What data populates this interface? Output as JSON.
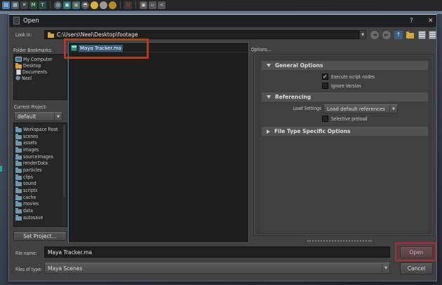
{
  "toolbar": {
    "icons": [
      {
        "name": "new-scene-icon",
        "glyph": "▤",
        "bg": "#4a7ab0",
        "fg": "#dce8f5",
        "shape": "sq"
      },
      {
        "name": "open-scene-icon",
        "glyph": "▦",
        "bg": "#4f5a66",
        "fg": "#c8d4e0",
        "shape": "sq"
      },
      {
        "name": "save-scene-icon",
        "glyph": "✕",
        "bg": "#3a4048",
        "fg": "#e8eef5",
        "shape": "sq"
      },
      {
        "name": "import-icon",
        "glyph": "M",
        "bg": "#2e4a3a",
        "fg": "#cfe8d8",
        "shape": "sq"
      },
      {
        "name": "export-icon",
        "glyph": "T",
        "bg": "#2e4a44",
        "fg": "#cfe8e0",
        "shape": "sq"
      },
      {
        "name": "sep",
        "glyph": "",
        "bg": "",
        "fg": "",
        "shape": "sep"
      },
      {
        "name": "render-globe-icon",
        "glyph": "◍",
        "bg": "#46606a",
        "fg": "#bcd",
        "shape": "round"
      },
      {
        "name": "cube-icon",
        "glyph": "▣",
        "bg": "#2e6e6e",
        "fg": "#bfe8e0",
        "shape": "sq"
      },
      {
        "name": "cube-axis-icon",
        "glyph": "▣",
        "bg": "#376f7d",
        "fg": "#e0a860",
        "shape": "sq"
      },
      {
        "name": "checker-sphere-icon",
        "glyph": "◓",
        "bg": "#5a5a5a",
        "fg": "#ddd",
        "shape": "round"
      },
      {
        "name": "yellow-sphere-icon",
        "glyph": "",
        "bg": "#d2b53c",
        "fg": "#fff",
        "shape": "round"
      },
      {
        "name": "gray-sphere-icon",
        "glyph": "",
        "bg": "#9a9a9a",
        "fg": "#fff",
        "shape": "round"
      },
      {
        "name": "gold-sphere-icon",
        "glyph": "",
        "bg": "#b8862e",
        "fg": "#fff",
        "shape": "round"
      },
      {
        "name": "sep",
        "glyph": "",
        "bg": "",
        "fg": "",
        "shape": "sep"
      },
      {
        "name": "snap-magnet-icon",
        "glyph": "U",
        "bg": "#3a3a3a",
        "fg": "#d04038",
        "shape": "sq"
      },
      {
        "name": "sep",
        "glyph": "",
        "bg": "",
        "fg": "",
        "shape": "sep"
      },
      {
        "name": "isolate-cube-icon",
        "glyph": "▣",
        "bg": "#555",
        "fg": "#ccc",
        "shape": "sq"
      },
      {
        "name": "duplicate-icon",
        "glyph": "▱",
        "bg": "#555",
        "fg": "#ccc",
        "shape": "sq"
      },
      {
        "name": "share-icon",
        "glyph": "<",
        "bg": "#555",
        "fg": "#ccc",
        "shape": "sq"
      }
    ]
  },
  "dialog": {
    "title": "Open",
    "titlebar": {
      "help": "?",
      "close": "✕"
    },
    "look_in": {
      "label": "Look in:",
      "path": "C:\\Users\\Neel\\Desktop\\footage"
    },
    "bookmarks": {
      "label": "Folder Bookmarks:",
      "items": [
        {
          "label": "My Computer",
          "icon": "computer"
        },
        {
          "label": "Desktop",
          "icon": "folder-yellow"
        },
        {
          "label": "Documents",
          "icon": "document"
        },
        {
          "label": "Neel",
          "icon": "user"
        }
      ]
    },
    "current_project": {
      "label": "Current Project:",
      "value": "default"
    },
    "projects": [
      "Workspace Root",
      "scenes",
      "assets",
      "images",
      "sourceimages",
      "renderData",
      "particles",
      "clips",
      "sound",
      "scripts",
      "cache",
      "movies",
      "data",
      "autosave"
    ],
    "set_project_label": "Set Project...",
    "file_list": {
      "selected_file": "Maya Tracker.ma"
    },
    "options": {
      "label": "Options...",
      "sections": [
        {
          "title": "General Options",
          "expanded": true,
          "checkboxes": [
            {
              "label": "Execute script nodes",
              "checked": true
            },
            {
              "label": "Ignore Version",
              "checked": false
            }
          ]
        },
        {
          "title": "Referencing",
          "expanded": true,
          "load_settings": {
            "label": "Load Settings",
            "value": "Load default references"
          },
          "checkboxes": [
            {
              "label": "Selective preload",
              "checked": false
            }
          ]
        },
        {
          "title": "File Type Specific Options",
          "expanded": false
        }
      ]
    },
    "file_name": {
      "label": "File name:",
      "value": "Maya Tracker.ma"
    },
    "files_of_type": {
      "label": "Files of type:",
      "value": "Maya Scenes"
    },
    "open_label": "Open",
    "cancel_label": "Cancel"
  },
  "annotations": {
    "file_highlight_color": "#d7281d",
    "open_highlight_color": "#9c3139"
  }
}
